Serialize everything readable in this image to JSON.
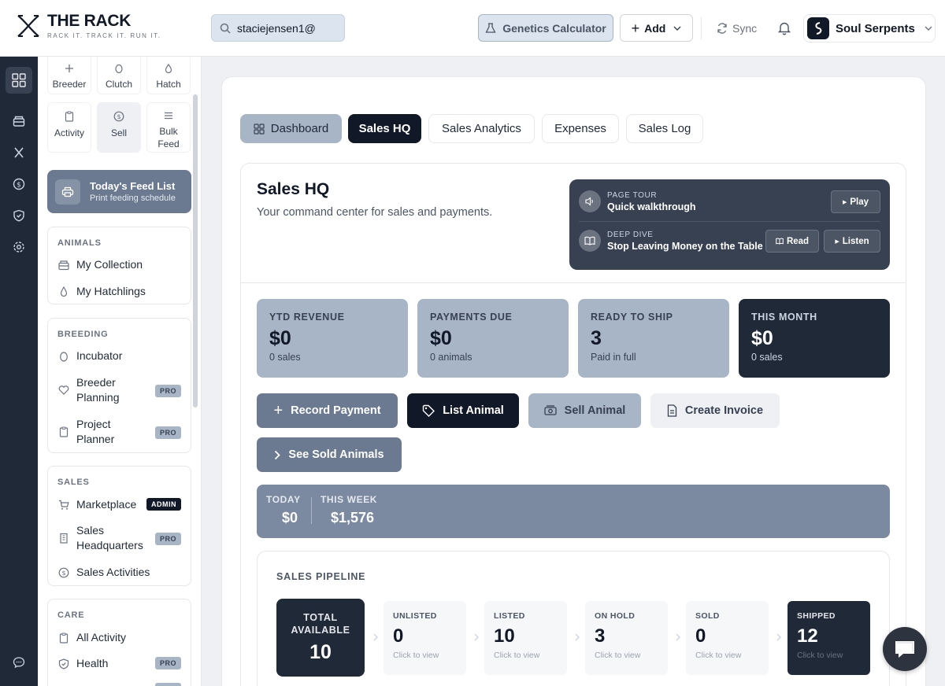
{
  "brand": {
    "title": "THE RACK",
    "tagline": "RACK IT. TRACK IT. RUN IT."
  },
  "search": {
    "value": "staciejensen1@",
    "placeholder": "Search"
  },
  "topbar": {
    "genetics_label": "Genetics Calculator",
    "add_label": "Add",
    "sync_label": "Sync",
    "account_name": "Soul Serpents"
  },
  "sidebar": {
    "quick_actions": [
      {
        "label": "Breeder",
        "icon": "plus-icon"
      },
      {
        "label": "Clutch",
        "icon": "egg-icon"
      },
      {
        "label": "Hatch",
        "icon": "drop-icon"
      },
      {
        "label": "Activity",
        "icon": "clipboard-icon"
      },
      {
        "label": "Sell",
        "icon": "dollar-icon"
      },
      {
        "label": "Bulk Feed",
        "icon": "list-icon"
      }
    ],
    "feed_card": {
      "title": "Today's Feed List",
      "subtitle": "Print feeding schedule"
    },
    "animals": {
      "header": "ANIMALS",
      "items": [
        "My Collection",
        "My Hatchlings"
      ]
    },
    "breeding": {
      "header": "BREEDING",
      "items": [
        "Incubator",
        "Breeder Planning",
        "Project Planner"
      ]
    },
    "sales": {
      "header": "SALES",
      "items": [
        "Marketplace",
        "Sales Headquarters",
        "Sales Activities"
      ]
    },
    "care": {
      "header": "CARE",
      "items": [
        "All Activity",
        "Health"
      ]
    },
    "badges": {
      "pro": "PRO",
      "admin": "ADMIN"
    }
  },
  "tabs": [
    "Dashboard",
    "Sales HQ",
    "Sales Analytics",
    "Expenses",
    "Sales Log"
  ],
  "header": {
    "title": "Sales HQ",
    "subtitle": "Your command center for sales and payments."
  },
  "tour": {
    "tour_kicker": "PAGE TOUR",
    "tour_title": "Quick walkthrough",
    "play_label": "Play",
    "dive_kicker": "DEEP DIVE",
    "dive_title": "Stop Leaving Money on the Table",
    "read_label": "Read",
    "listen_label": "Listen"
  },
  "stats": [
    {
      "label": "YTD REVENUE",
      "value": "$0",
      "sub": "0 sales"
    },
    {
      "label": "PAYMENTS DUE",
      "value": "$0",
      "sub": "0 animals"
    },
    {
      "label": "READY TO SHIP",
      "value": "3",
      "sub": "Paid in full"
    },
    {
      "label": "THIS MONTH",
      "value": "$0",
      "sub": "0 sales"
    }
  ],
  "actions": {
    "record_payment": "Record Payment",
    "list_animal": "List Animal",
    "sell_animal": "Sell Animal",
    "create_invoice": "Create Invoice",
    "see_sold": "See Sold Animals"
  },
  "summary": {
    "today_label": "TODAY",
    "today_value": "$0",
    "week_label": "THIS WEEK",
    "week_value": "$1,576"
  },
  "pipeline": {
    "header": "SALES PIPELINE",
    "total_label": "TOTAL AVAILABLE",
    "total_value": "10",
    "click_hint": "Click to view",
    "stages": [
      {
        "label": "UNLISTED",
        "value": "0"
      },
      {
        "label": "LISTED",
        "value": "10"
      },
      {
        "label": "ON HOLD",
        "value": "3"
      },
      {
        "label": "SOLD",
        "value": "0"
      },
      {
        "label": "SHIPPED",
        "value": "12"
      }
    ]
  }
}
